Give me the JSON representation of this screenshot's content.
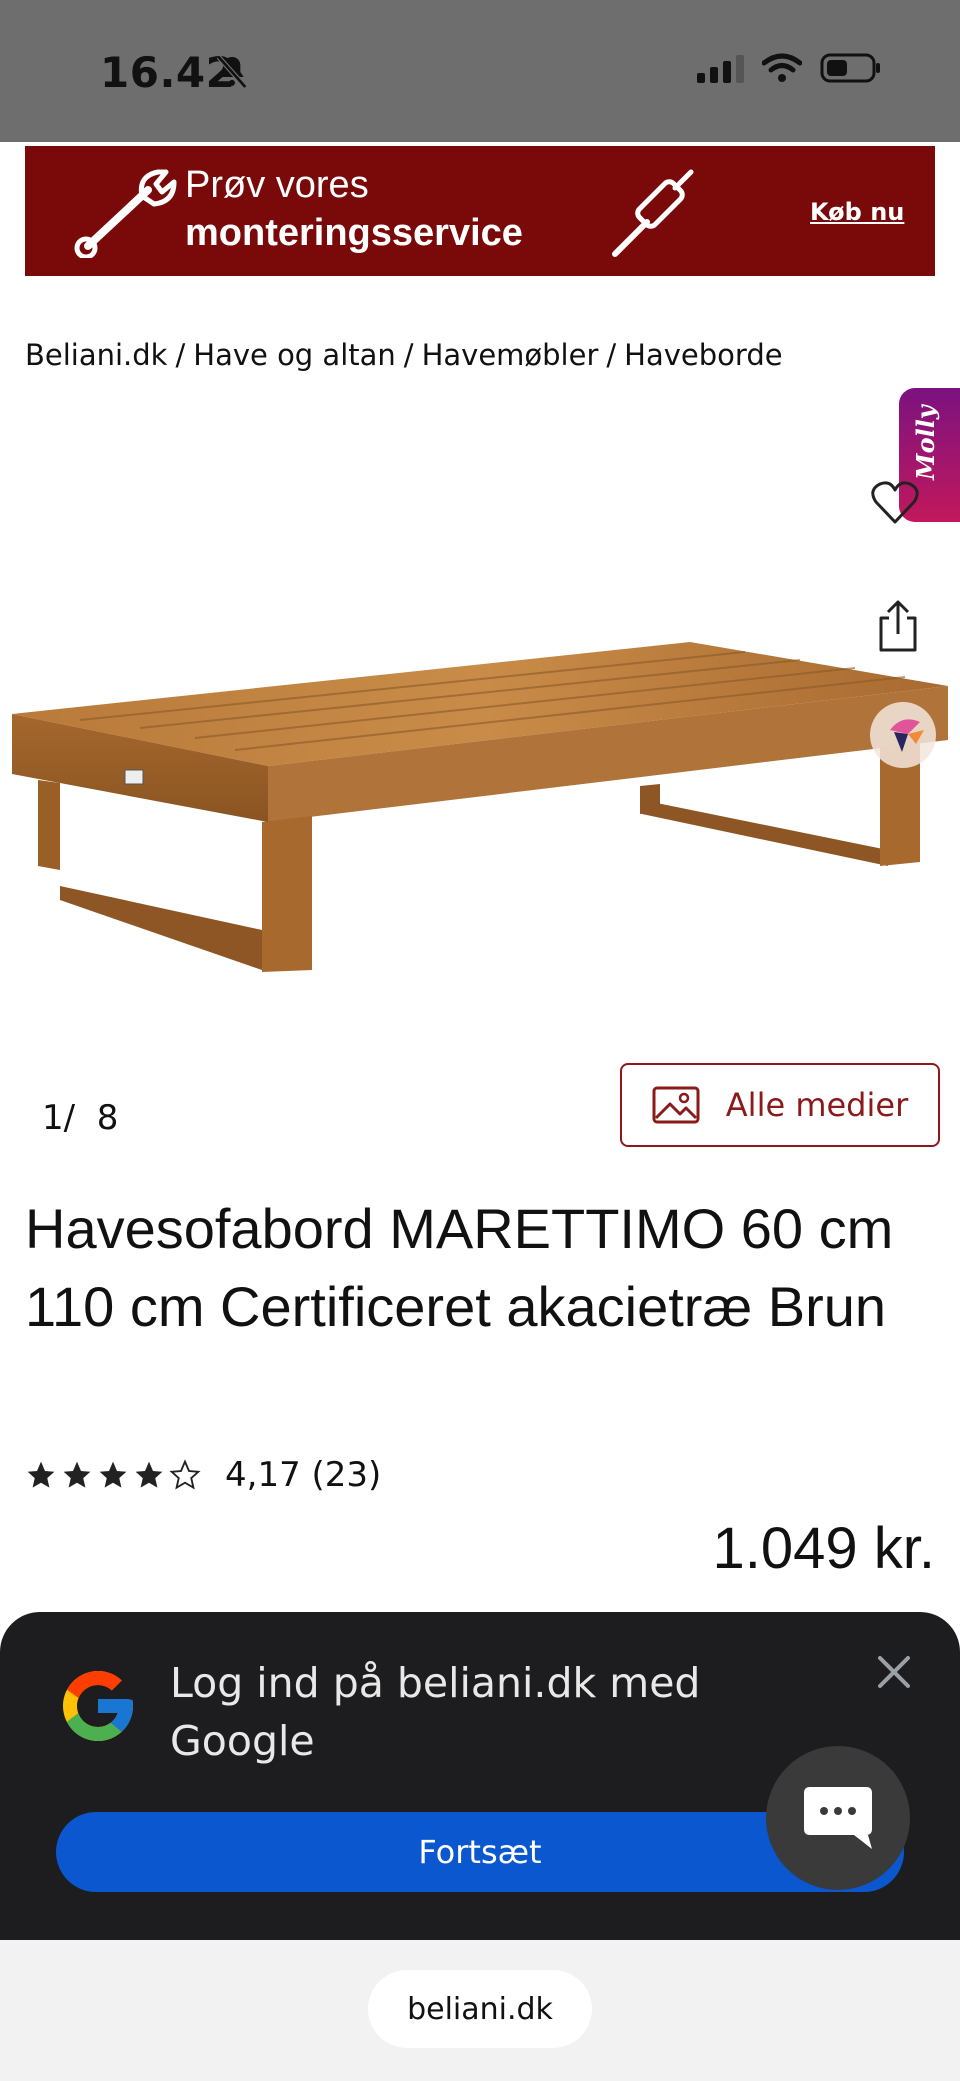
{
  "status_bar": {
    "time": "16.42"
  },
  "banner": {
    "line1": "Prøv vores",
    "line2": "monteringsservice",
    "cta": "Køb nu"
  },
  "breadcrumb": [
    "Beliani.dk",
    "Have og altan",
    "Havemøbler",
    "Haveborde"
  ],
  "molly_tab": {
    "label": "Molly"
  },
  "gallery": {
    "current": "1",
    "separator": "/",
    "total": "8",
    "all_media_label": "Alle medier"
  },
  "product": {
    "title": "Havesofabord MARETTIMO 60 cm 110 cm Certificeret akacietræ Brun",
    "rating": 4.17,
    "rating_text": "4,17 (23)",
    "price": "1.049 kr."
  },
  "google_signin": {
    "text": "Log ind på beliani.dk med Google",
    "continue_label": "Fortsæt"
  },
  "browser": {
    "url": "beliani.dk"
  },
  "colors": {
    "brand_red": "#7a0a0a",
    "google_blue": "#0b57d0",
    "sheet_bg": "#1d1d1f"
  }
}
